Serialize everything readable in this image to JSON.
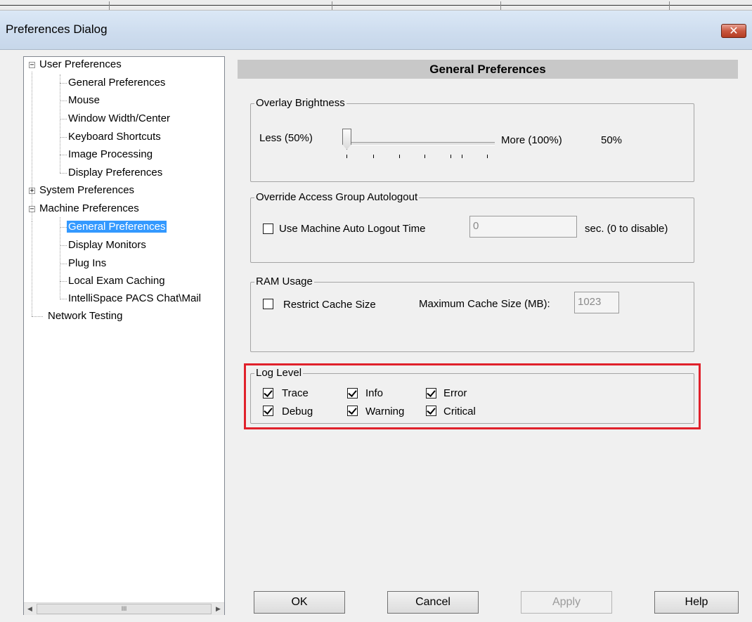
{
  "window": {
    "title": "Preferences Dialog",
    "close_glyph": "✕"
  },
  "tree": {
    "nodes": [
      {
        "label": "User Preferences",
        "expander": "−"
      },
      {
        "label": "General Preferences"
      },
      {
        "label": "Mouse"
      },
      {
        "label": "Window Width/Center"
      },
      {
        "label": "Keyboard Shortcuts"
      },
      {
        "label": "Image Processing"
      },
      {
        "label": "Display Preferences"
      },
      {
        "label": "System Preferences",
        "expander": "+"
      },
      {
        "label": "Machine Preferences",
        "expander": "−"
      },
      {
        "label": "General Preferences",
        "selected": true
      },
      {
        "label": "Display Monitors"
      },
      {
        "label": "Plug Ins"
      },
      {
        "label": "Local Exam Caching"
      },
      {
        "label": "IntelliSpace PACS Chat\\Mail"
      },
      {
        "label": "Network Testing"
      }
    ],
    "scroll_left_glyph": "◀",
    "scroll_right_glyph": "▶",
    "scroll_thumb_glyph": "III"
  },
  "panel": {
    "title": "General Preferences"
  },
  "overlay_brightness": {
    "legend": "Overlay Brightness",
    "less_label": "Less (50%)",
    "more_label": "More (100%)",
    "value_label": "50%",
    "value_fraction": 0.0
  },
  "autologout": {
    "legend": "Override Access Group Autologout",
    "checkbox_label": "Use Machine Auto Logout Time",
    "checked": false,
    "value": "0",
    "suffix": "sec. (0 to disable)"
  },
  "ram": {
    "legend": "RAM Usage",
    "checkbox_label": "Restrict Cache Size",
    "checked": false,
    "max_label": "Maximum Cache Size (MB):",
    "max_value": "1023"
  },
  "log_level": {
    "legend": "Log Level",
    "items": [
      {
        "label": "Trace",
        "checked": true
      },
      {
        "label": "Info",
        "checked": true
      },
      {
        "label": "Error",
        "checked": true
      },
      {
        "label": "Debug",
        "checked": true
      },
      {
        "label": "Warning",
        "checked": true
      },
      {
        "label": "Critical",
        "checked": true
      }
    ]
  },
  "buttons": {
    "ok": "OK",
    "cancel": "Cancel",
    "apply": "Apply",
    "help": "Help"
  },
  "colors": {
    "selection": "#3399ff",
    "highlight_box": "#e0212b",
    "close_button": "#c9573f"
  }
}
